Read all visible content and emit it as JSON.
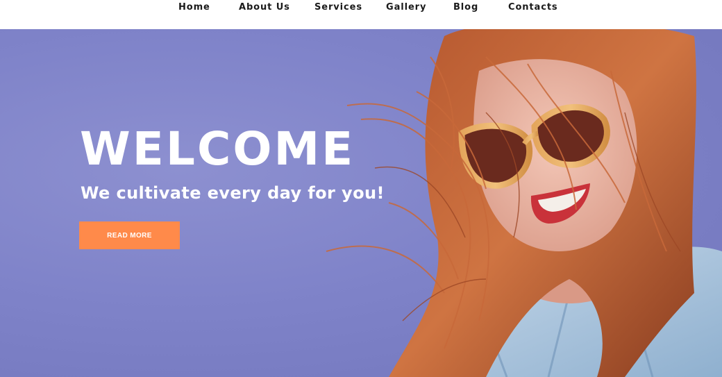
{
  "nav": {
    "items": [
      {
        "label": "Home"
      },
      {
        "label": "About Us"
      },
      {
        "label": "Services"
      },
      {
        "label": "Gallery"
      },
      {
        "label": "Blog"
      },
      {
        "label": "Contacts"
      }
    ]
  },
  "hero": {
    "title": "WELCOME",
    "subtitle": "We cultivate every day for you!",
    "cta_label": "READ MORE",
    "background_color": "#7f83c9",
    "cta_color": "#ff8a4a"
  }
}
